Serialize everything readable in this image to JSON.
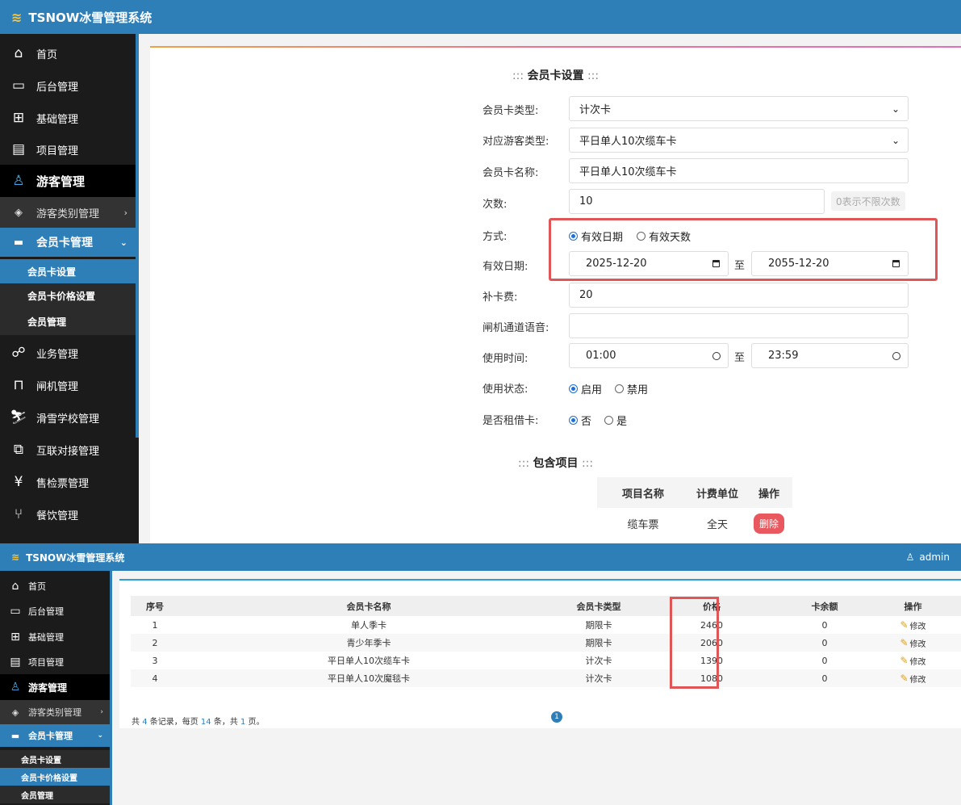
{
  "app_title": "TSNOW冰雪管理系统",
  "user": "admin",
  "sidebar1": {
    "home": "首页",
    "backend": "后台管理",
    "basic": "基础管理",
    "project": "项目管理",
    "visitor": "游客管理",
    "visitor_type": "游客类别管理",
    "card_mgmt": "会员卡管理",
    "card_settings": "会员卡设置",
    "card_price": "会员卡价格设置",
    "member_mgmt": "会员管理",
    "business": "业务管理",
    "gate": "闸机管理",
    "ski_school": "滑雪学校管理",
    "interconnect": "互联对接管理",
    "ticketing": "售检票管理",
    "catering": "餐饮管理"
  },
  "form": {
    "section_title": "会员卡设置",
    "card_type_label": "会员卡类型:",
    "card_type_value": "计次卡",
    "visitor_type_label": "对应游客类型:",
    "visitor_type_value": "平日单人10次缆车卡",
    "card_name_label": "会员卡名称:",
    "card_name_value": "平日单人10次缆车卡",
    "count_label": "次数:",
    "count_value": "10",
    "count_hint": "0表示不限次数",
    "mode_label": "方式:",
    "mode_opt1": "有效日期",
    "mode_opt2": "有效天数",
    "valid_date_label": "有效日期:",
    "date_from": "2025-12-20",
    "date_to": "2055-12-20",
    "to_word": "至",
    "reissue_fee_label": "补卡费:",
    "reissue_fee_value": "20",
    "gate_voice_label": "闸机通道语音:",
    "gate_voice_value": "",
    "use_time_label": "使用时间:",
    "time_from": "01:00",
    "time_to": "23:59",
    "status_label": "使用状态:",
    "status_opt1": "启用",
    "status_opt2": "禁用",
    "rental_label": "是否租借卡:",
    "rental_opt1": "否",
    "rental_opt2": "是"
  },
  "included": {
    "title": "包含项目",
    "headers": [
      "项目名称",
      "计费单位",
      "操作"
    ],
    "rows": [
      {
        "name": "缆车票",
        "unit": "全天",
        "action": "删除"
      }
    ]
  },
  "price_table": {
    "headers": [
      "序号",
      "会员卡名称",
      "会员卡类型",
      "价格",
      "卡余额",
      "操作"
    ],
    "rows": [
      {
        "no": "1",
        "name": "单人季卡",
        "type": "期限卡",
        "price": "2460",
        "balance": "0",
        "action": "修改"
      },
      {
        "no": "2",
        "name": "青少年季卡",
        "type": "期限卡",
        "price": "2060",
        "balance": "0",
        "action": "修改"
      },
      {
        "no": "3",
        "name": "平日单人10次缆车卡",
        "type": "计次卡",
        "price": "1390",
        "balance": "0",
        "action": "修改"
      },
      {
        "no": "4",
        "name": "平日单人10次魔毯卡",
        "type": "计次卡",
        "price": "1080",
        "balance": "0",
        "action": "修改"
      }
    ],
    "pager": {
      "p1": "共 ",
      "total": "4",
      "p2": " 条记录，每页 ",
      "per": "14",
      "p3": " 条，共 ",
      "pages": "1",
      "p4": " 页。",
      "current": "1"
    }
  }
}
